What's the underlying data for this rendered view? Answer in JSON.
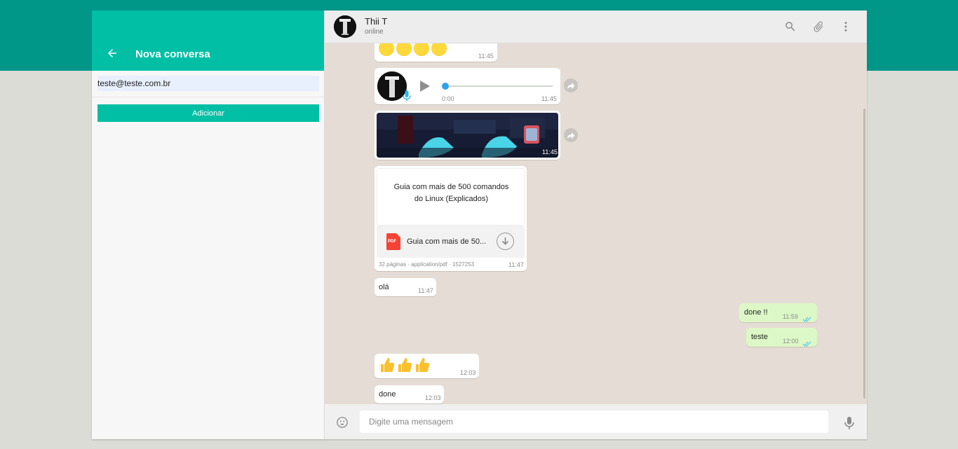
{
  "left_panel": {
    "title": "Nova conversa",
    "email_value": "teste@teste.com.br",
    "add_label": "Adicionar"
  },
  "chat": {
    "contact_name": "Thii T",
    "contact_status": "online",
    "messages": {
      "emoji_row_time": "11:45",
      "audio": {
        "current": "0:00",
        "time": "11:45"
      },
      "image_time": "11:45",
      "document": {
        "preview_line1": "Guia com mais de 500 comandos",
        "preview_line2": "do Linux (Explicados)",
        "file_badge": "PDF",
        "file_name": "Guia com mais de 50...",
        "meta": "32 páginas  ·  application/pdf  ·  1527253",
        "time": "11:47"
      },
      "ola": {
        "text": "olá",
        "time": "11:47"
      },
      "done_out": {
        "text": "done !!",
        "time": "11:59"
      },
      "teste_out": {
        "text": "teste",
        "time": "12:00"
      },
      "thumbs_time": "12:03",
      "done_in": {
        "text": "done",
        "time": "12:03"
      }
    },
    "composer_placeholder": "Digite uma mensagem"
  },
  "icons": [
    "back-arrow-icon",
    "search-icon",
    "paperclip-icon",
    "more-vert-icon",
    "play-icon",
    "mic-icon",
    "forward-icon",
    "download-icon",
    "pdf-icon",
    "smiley-icon",
    "double-check-icon"
  ],
  "colors": {
    "teal_band": "#009688",
    "teal_header": "#00bfa5",
    "chat_bg": "#e5ddd5",
    "outgoing_bubble": "#dcf8c6",
    "read_check": "#4fc3f7"
  }
}
